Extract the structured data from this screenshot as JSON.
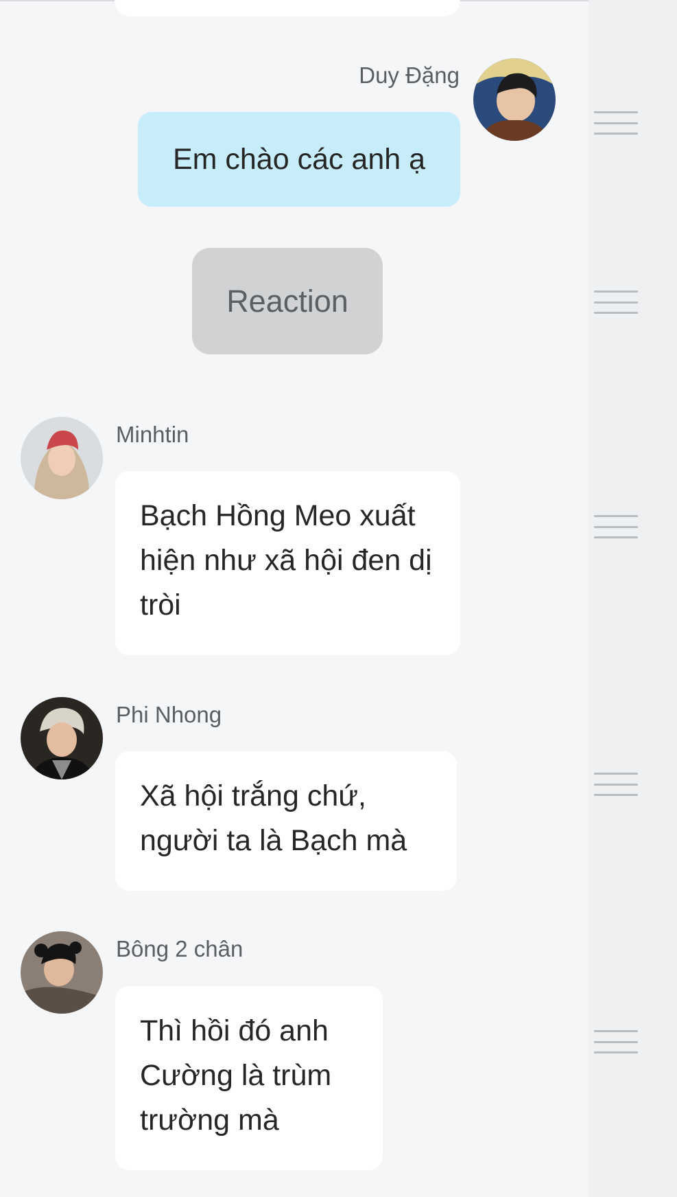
{
  "messages": [
    {
      "sender": "Duy Đặng",
      "text": "Em chào các anh ạ",
      "own": true
    },
    {
      "sender": "Minhtin",
      "text": "Bạch Hồng Meo xuất hiện như xã hội đen dị tròi"
    },
    {
      "sender": "Phi Nhong",
      "text": "Xã hội trắng chứ, người ta là Bạch mà"
    },
    {
      "sender": "Bông 2 chân",
      "text": "Thì hồi đó anh Cường là trùm trường mà"
    }
  ],
  "reaction_label": "Reaction",
  "colors": {
    "own_bubble": "#c7edfb",
    "other_bubble": "#ffffff",
    "background": "#f5f6f8",
    "reaction_button": "#d1d2d4"
  }
}
